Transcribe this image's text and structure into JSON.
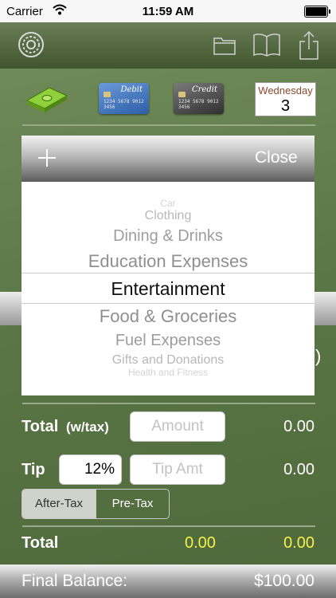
{
  "status_bar": {
    "carrier": "Carrier",
    "time": "11:59 AM"
  },
  "toolbar": {
    "icons": [
      "settings-icon",
      "folder-icon",
      "book-icon",
      "share-icon"
    ]
  },
  "payment": {
    "debit_label": "Debit",
    "credit_label": "Credit",
    "card_number": "1234 5678 9012 3456"
  },
  "date": {
    "weekday": "Wednesday",
    "day": "3"
  },
  "picker_header": {
    "add_icon": "plus-icon",
    "close_label": "Close"
  },
  "category_picker": {
    "items": [
      "Car",
      "Clothing",
      "Dining & Drinks",
      "Education Expenses",
      "Entertainment",
      "Food & Groceries",
      "Fuel Expenses",
      "Gifts and Donations",
      "Health and Fitness"
    ],
    "selected": "Entertainment"
  },
  "total_row": {
    "label": "Total",
    "suffix": "(w/tax)",
    "amount_placeholder": "Amount",
    "value": "0.00"
  },
  "tip_row": {
    "label": "Tip",
    "percent": "12%",
    "tip_placeholder": "Tip Amt",
    "value": "0.00"
  },
  "tip_mode": {
    "after_tax": "After-Tax",
    "pre_tax": "Pre-Tax",
    "selected": "After-Tax"
  },
  "grand_total": {
    "label": "Total",
    "value_1": "0.00",
    "value_2": "0.00"
  },
  "final_balance": {
    "label": "Final Balance:",
    "value": "$100.00"
  },
  "colors": {
    "highlight_yellow": "#f4f04a",
    "background_green": "#5b7645"
  }
}
